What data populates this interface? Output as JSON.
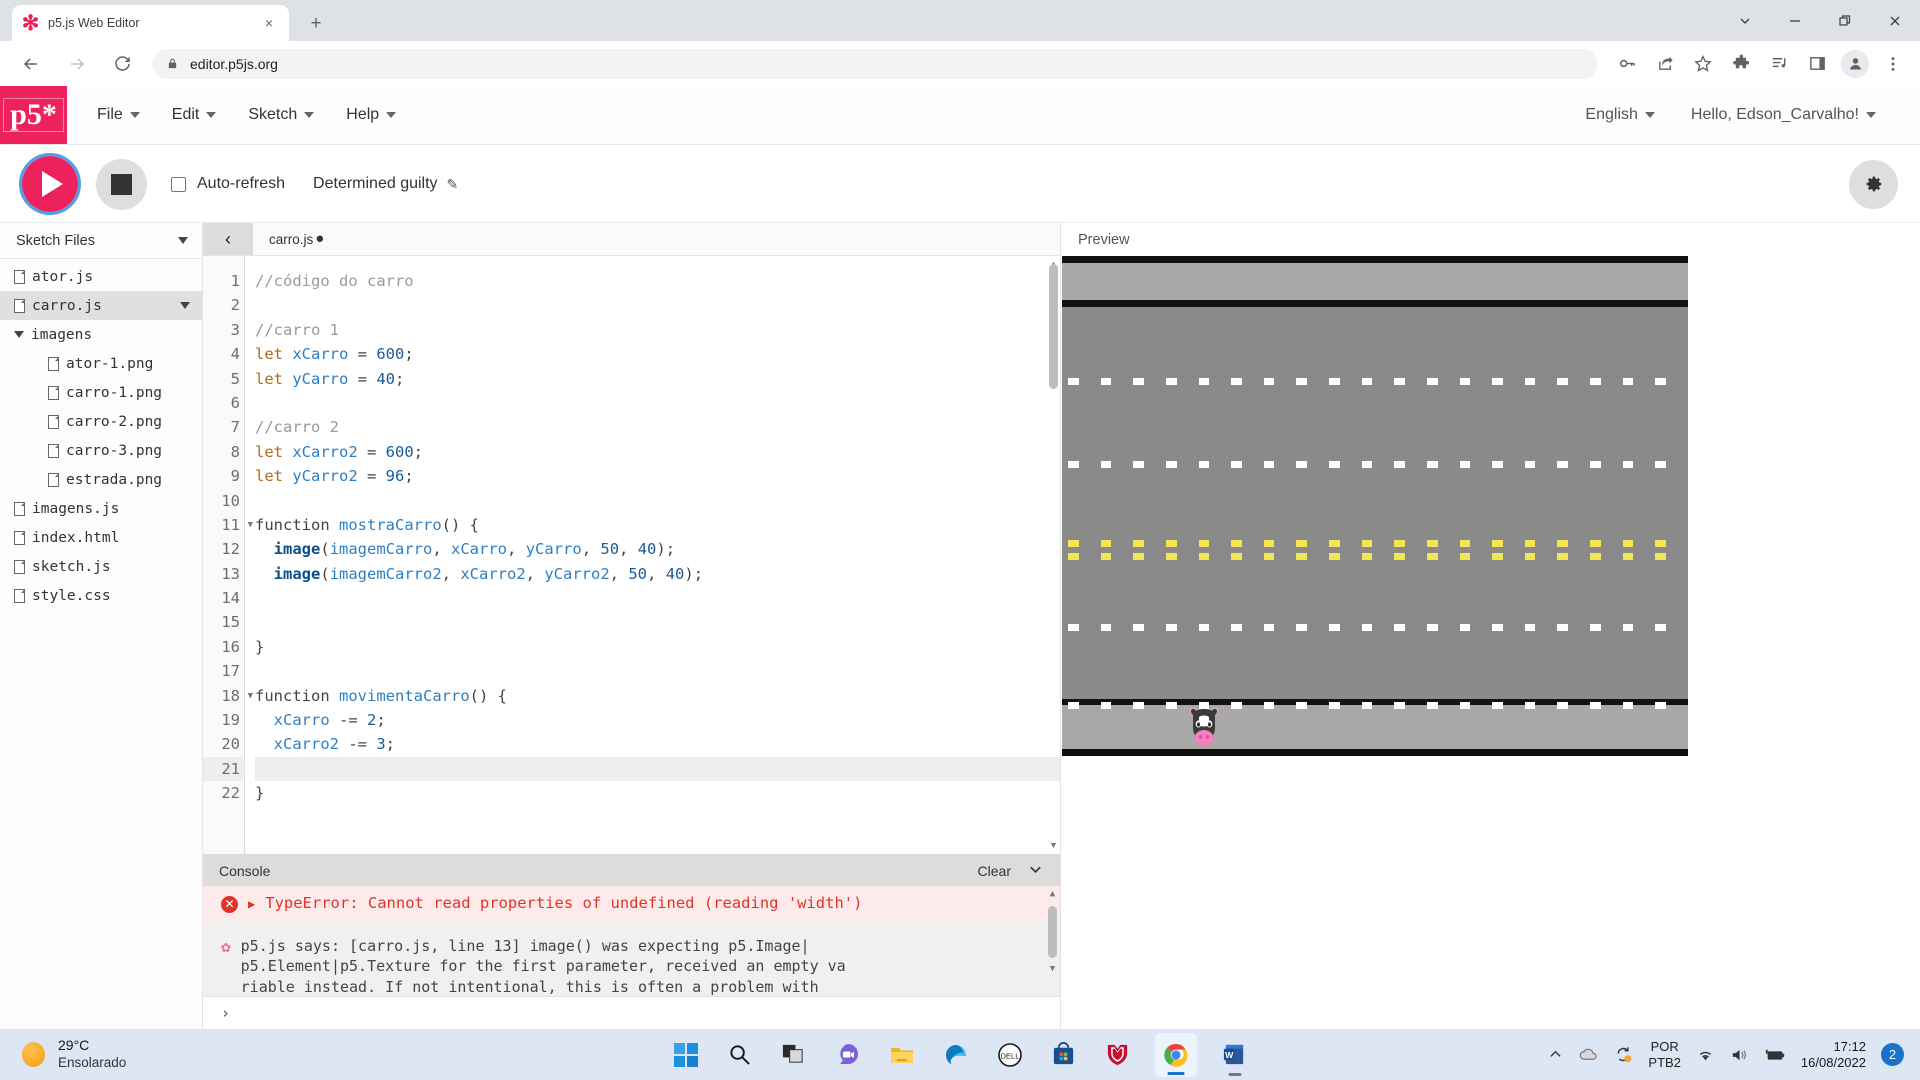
{
  "browser": {
    "tab": {
      "title": "p5.js Web Editor",
      "favicon": "p5-asterisk-icon",
      "close": "×"
    },
    "new_tab": "+",
    "window_controls": [
      "chevron-down-icon",
      "minimize-icon",
      "restore-icon",
      "close-icon"
    ],
    "nav": {
      "back": "←",
      "forward": "→",
      "reload": "⟳"
    },
    "omnibox": {
      "url": "editor.p5js.org",
      "lock": "lock-icon"
    },
    "toolbar_icons": [
      "key-icon",
      "share-icon",
      "bookmark-star-icon",
      "extensions-puzzle-icon",
      "media-playlist-icon",
      "side-panel-icon",
      "profile-avatar-icon",
      "chrome-menu-icon"
    ]
  },
  "p5nav": {
    "logo": "p5*",
    "menus": [
      "File",
      "Edit",
      "Sketch",
      "Help"
    ],
    "language": "English",
    "account": "Hello, Edson_Carvalho!"
  },
  "toolbar": {
    "play": "play-button",
    "stop": "stop-button",
    "auto_refresh_label": "Auto-refresh",
    "auto_refresh_checked": false,
    "sketch_name": "Determined guilty",
    "edit_pencil": "✎",
    "settings": "gear-icon"
  },
  "sidebar": {
    "title": "Sketch Files",
    "files": [
      {
        "name": "ator.js",
        "type": "file",
        "depth": 0,
        "selected": false
      },
      {
        "name": "carro.js",
        "type": "file",
        "depth": 0,
        "selected": true
      },
      {
        "name": "imagens",
        "type": "folder",
        "depth": 0,
        "selected": false,
        "expanded": true
      },
      {
        "name": "ator-1.png",
        "type": "file",
        "depth": 1,
        "selected": false
      },
      {
        "name": "carro-1.png",
        "type": "file",
        "depth": 1,
        "selected": false
      },
      {
        "name": "carro-2.png",
        "type": "file",
        "depth": 1,
        "selected": false
      },
      {
        "name": "carro-3.png",
        "type": "file",
        "depth": 1,
        "selected": false
      },
      {
        "name": "estrada.png",
        "type": "file",
        "depth": 1,
        "selected": false
      },
      {
        "name": "imagens.js",
        "type": "file",
        "depth": 0,
        "selected": false
      },
      {
        "name": "index.html",
        "type": "file",
        "depth": 0,
        "selected": false
      },
      {
        "name": "sketch.js",
        "type": "file",
        "depth": 0,
        "selected": false
      },
      {
        "name": "style.css",
        "type": "file",
        "depth": 0,
        "selected": false
      }
    ]
  },
  "editor": {
    "collapse_icon": "‹",
    "open_tab": "carro.js",
    "unsaved_marker": "●",
    "active_line": 21,
    "fold_lines": [
      11,
      18
    ],
    "lines": [
      {
        "n": 1,
        "tokens": [
          {
            "t": "//código do carro",
            "c": "cm"
          }
        ]
      },
      {
        "n": 2,
        "tokens": []
      },
      {
        "n": 3,
        "tokens": [
          {
            "t": "//carro 1",
            "c": "cm"
          }
        ]
      },
      {
        "n": 4,
        "tokens": [
          {
            "t": "let ",
            "c": "kw"
          },
          {
            "t": "xCarro",
            "c": "var"
          },
          {
            "t": " = ",
            "c": "pn"
          },
          {
            "t": "600",
            "c": "num"
          },
          {
            "t": ";",
            "c": "pn"
          }
        ]
      },
      {
        "n": 5,
        "tokens": [
          {
            "t": "let ",
            "c": "kw"
          },
          {
            "t": "yCarro",
            "c": "var"
          },
          {
            "t": " = ",
            "c": "pn"
          },
          {
            "t": "40",
            "c": "num"
          },
          {
            "t": ";",
            "c": "pn"
          }
        ]
      },
      {
        "n": 6,
        "tokens": []
      },
      {
        "n": 7,
        "tokens": [
          {
            "t": "//carro 2",
            "c": "cm"
          }
        ]
      },
      {
        "n": 8,
        "tokens": [
          {
            "t": "let ",
            "c": "kw"
          },
          {
            "t": "xCarro2",
            "c": "var"
          },
          {
            "t": " = ",
            "c": "pn"
          },
          {
            "t": "600",
            "c": "num"
          },
          {
            "t": ";",
            "c": "pn"
          }
        ]
      },
      {
        "n": 9,
        "tokens": [
          {
            "t": "let ",
            "c": "kw"
          },
          {
            "t": "yCarro2",
            "c": "var"
          },
          {
            "t": " = ",
            "c": "pn"
          },
          {
            "t": "96",
            "c": "num"
          },
          {
            "t": ";",
            "c": "pn"
          }
        ]
      },
      {
        "n": 10,
        "tokens": []
      },
      {
        "n": 11,
        "tokens": [
          {
            "t": "function ",
            "c": "pn"
          },
          {
            "t": "mostraCarro",
            "c": "fn"
          },
          {
            "t": "() {",
            "c": "pn"
          }
        ]
      },
      {
        "n": 12,
        "tokens": [
          {
            "t": "  ",
            "c": "pn"
          },
          {
            "t": "image",
            "c": "bi"
          },
          {
            "t": "(",
            "c": "pn"
          },
          {
            "t": "imagemCarro",
            "c": "var"
          },
          {
            "t": ", ",
            "c": "pn"
          },
          {
            "t": "xCarro",
            "c": "var"
          },
          {
            "t": ", ",
            "c": "pn"
          },
          {
            "t": "yCarro",
            "c": "var"
          },
          {
            "t": ", ",
            "c": "pn"
          },
          {
            "t": "50",
            "c": "num"
          },
          {
            "t": ", ",
            "c": "pn"
          },
          {
            "t": "40",
            "c": "num"
          },
          {
            "t": ");",
            "c": "pn"
          }
        ]
      },
      {
        "n": 13,
        "tokens": [
          {
            "t": "  ",
            "c": "pn"
          },
          {
            "t": "image",
            "c": "bi"
          },
          {
            "t": "(",
            "c": "pn"
          },
          {
            "t": "imagemCarro2",
            "c": "var"
          },
          {
            "t": ", ",
            "c": "pn"
          },
          {
            "t": "xCarro2",
            "c": "var"
          },
          {
            "t": ", ",
            "c": "pn"
          },
          {
            "t": "yCarro2",
            "c": "var"
          },
          {
            "t": ", ",
            "c": "pn"
          },
          {
            "t": "50",
            "c": "num"
          },
          {
            "t": ", ",
            "c": "pn"
          },
          {
            "t": "40",
            "c": "num"
          },
          {
            "t": ");",
            "c": "pn"
          }
        ]
      },
      {
        "n": 14,
        "tokens": []
      },
      {
        "n": 15,
        "tokens": []
      },
      {
        "n": 16,
        "tokens": [
          {
            "t": "}",
            "c": "pn"
          }
        ]
      },
      {
        "n": 17,
        "tokens": []
      },
      {
        "n": 18,
        "tokens": [
          {
            "t": "function ",
            "c": "pn"
          },
          {
            "t": "movimentaCarro",
            "c": "fn"
          },
          {
            "t": "() {",
            "c": "pn"
          }
        ]
      },
      {
        "n": 19,
        "tokens": [
          {
            "t": "  ",
            "c": "pn"
          },
          {
            "t": "xCarro",
            "c": "var"
          },
          {
            "t": " -= ",
            "c": "pn"
          },
          {
            "t": "2",
            "c": "num"
          },
          {
            "t": ";",
            "c": "pn"
          }
        ]
      },
      {
        "n": 20,
        "tokens": [
          {
            "t": "  ",
            "c": "pn"
          },
          {
            "t": "xCarro2",
            "c": "var"
          },
          {
            "t": " -= ",
            "c": "pn"
          },
          {
            "t": "3",
            "c": "num"
          },
          {
            "t": ";",
            "c": "pn"
          }
        ]
      },
      {
        "n": 21,
        "tokens": []
      },
      {
        "n": 22,
        "tokens": [
          {
            "t": "}",
            "c": "pn"
          }
        ]
      }
    ]
  },
  "console": {
    "title": "Console",
    "clear_label": "Clear",
    "collapse_icon": "chevron-down-icon",
    "error": {
      "icon": "error-circle-icon",
      "expander": "▶",
      "text": "TypeError: Cannot read properties of undefined (reading 'width')"
    },
    "message": {
      "icon": "p5-flower-icon",
      "line1": "p5.js says: [carro.js, line 13] image() was expecting p5.Image|",
      "line2": "p5.Element|p5.Texture for the first parameter, received an empty va",
      "line3": "riable instead. If not intentional, this is often a problem with"
    },
    "prompt": "›"
  },
  "preview": {
    "title": "Preview",
    "canvas": {
      "road_color": "#8a8a8a",
      "shoulder_color": "#aaa7a7",
      "edge_color": "#111111",
      "lane_dash_color": "#ffffff",
      "center_line_color": "#f2e750",
      "character": "cow-icon"
    }
  },
  "taskbar": {
    "weather": {
      "temp": "29°C",
      "desc": "Ensolarado",
      "icon": "sun-icon"
    },
    "apps": [
      {
        "name": "start-button",
        "icon": "windows-icon"
      },
      {
        "name": "search-button",
        "icon": "search-icon"
      },
      {
        "name": "task-view-button",
        "icon": "task-view-icon"
      },
      {
        "name": "chat-button",
        "icon": "chat-video-icon"
      },
      {
        "name": "file-explorer-button",
        "icon": "folder-icon"
      },
      {
        "name": "edge-button",
        "icon": "edge-icon"
      },
      {
        "name": "dell-button",
        "icon": "dell-icon"
      },
      {
        "name": "store-button",
        "icon": "microsoft-store-icon"
      },
      {
        "name": "mcafee-button",
        "icon": "mcafee-shield-icon"
      },
      {
        "name": "chrome-button",
        "icon": "chrome-icon"
      },
      {
        "name": "word-button",
        "icon": "word-icon"
      }
    ],
    "tray": {
      "overflow": "chevron-up-icon",
      "cloud": "cloud-icon",
      "sync": "sync-icon",
      "lang_line1": "POR",
      "lang_line2": "PTB2",
      "wifi": "wifi-icon",
      "volume": "speaker-icon",
      "battery": "battery-charging-icon",
      "time": "17:12",
      "date": "16/08/2022",
      "notifications": "2"
    }
  }
}
